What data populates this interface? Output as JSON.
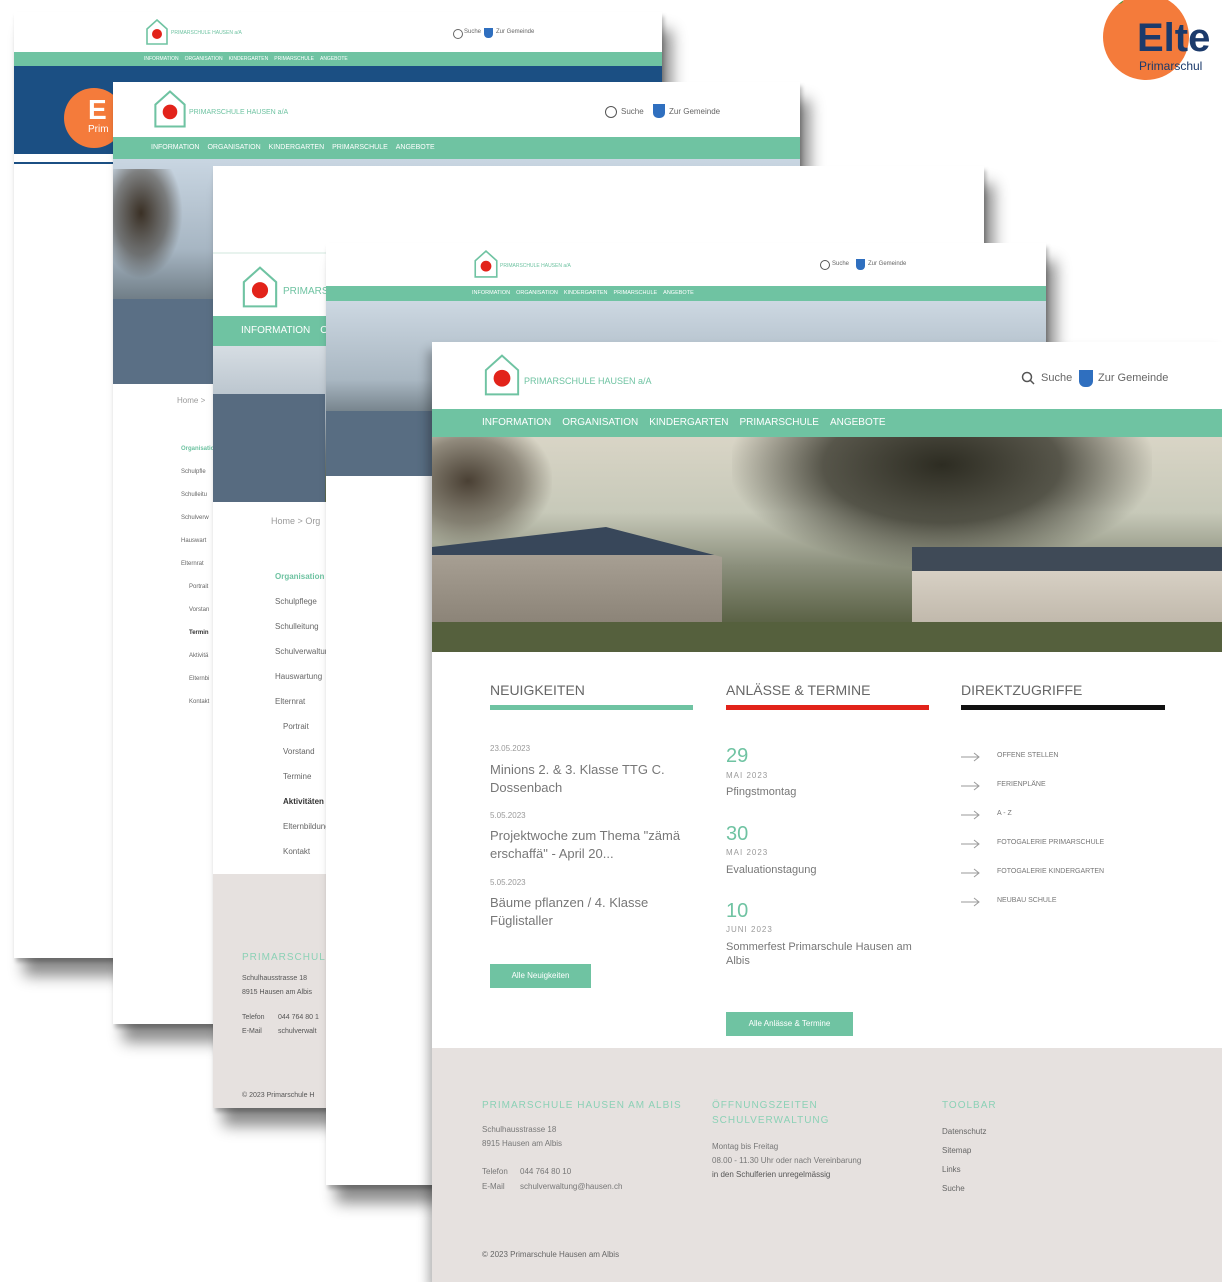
{
  "site": {
    "name": "PRIMARSCHULE HAUSEN a/A",
    "search_label": "Suche",
    "municipality_label": "Zur Gemeinde",
    "nav": [
      "INFORMATION",
      "ORGANISATION",
      "KINDERGARTEN",
      "PRIMARSCHULE",
      "ANGEBOTE"
    ]
  },
  "badge": {
    "big": "Elte",
    "small": "Primarschul",
    "letter": "E",
    "letter_small": "Prim"
  },
  "breadcrumb": {
    "home": "Home",
    "sep": ">",
    "partial": "Org"
  },
  "sidebar": {
    "title": "Organisation",
    "items": [
      "Schulpflege",
      "Schulleitung",
      "Schulverwaltung",
      "Hauswartung",
      "Elternrat"
    ],
    "subitems": [
      "Portrait",
      "Vorstand",
      "Termine",
      "Aktivitäten",
      "Elternbildung",
      "Kontakt"
    ],
    "card2_items": [
      "Organisation",
      "Schulpfle",
      "Schulleitu",
      "Schulverw",
      "Hauswart",
      "Elternrat",
      "Portrait",
      "Vorstan",
      "Termin",
      "Aktivitä",
      "Elternbi",
      "Kontakt"
    ]
  },
  "sections": {
    "news": {
      "title": "NEUIGKEITEN",
      "items": [
        {
          "date": "23.05.2023",
          "title_line1": "Minions 2. & 3. Klasse TTG C.",
          "title_line2": "Dossenbach"
        },
        {
          "date": "5.05.2023",
          "title_line1": "Projektwoche zum Thema \"zämä",
          "title_line2": "erschaffä\" - April 20..."
        },
        {
          "date": "5.05.2023",
          "title_line1": "Bäume pflanzen / 4. Klasse",
          "title_line2": "Füglistaller"
        }
      ],
      "button": "Alle Neuigkeiten"
    },
    "events": {
      "title": "ANLÄSSE & TERMINE",
      "items": [
        {
          "day": "29",
          "month": "MAI 2023",
          "title_line1": "Pfingstmontag",
          "title_line2": ""
        },
        {
          "day": "30",
          "month": "MAI 2023",
          "title_line1": "Evaluationstagung",
          "title_line2": ""
        },
        {
          "day": "10",
          "month": "JUNI 2023",
          "title_line1": "Sommerfest Primarschule Hausen am",
          "title_line2": "Albis"
        }
      ],
      "button": "Alle Anlässe & Termine"
    },
    "quick": {
      "title": "DIREKTZUGRIFFE",
      "items": [
        "OFFENE STELLEN",
        "FERIENPLÄNE",
        "A - Z",
        "FOTOGALERIE PRIMARSCHULE",
        "FOTOGALERIE KINDERGARTEN",
        "NEUBAU SCHULE"
      ]
    }
  },
  "footer": {
    "col1_title": "PRIMARSCHULE HAUSEN AM ALBIS",
    "col1_title_short": "PRIMARSCHUL",
    "address1": "Schulhausstrasse 18",
    "address2": "8915 Hausen am Albis",
    "phone_label": "Telefon",
    "phone": "044 764 80 10",
    "phone_short": "044 764 80 1",
    "email_label": "E-Mail",
    "email": "schulverwaltung@hausen.ch",
    "email_short": "schulverwalt",
    "col2_title1": "ÖFFNUNGSZEITEN",
    "col2_title2": "SCHULVERWALTUNG",
    "hours1": "Montag bis Freitag",
    "hours2": "08.00 - 11.30 Uhr oder nach Vereinbarung",
    "hours3": "in den Schulferien unregelmässig",
    "col3_title": "TOOLBAR",
    "tools": [
      "Datenschutz",
      "Sitemap",
      "Links",
      "Suche"
    ],
    "copyright": "© 2023 Primarschule Hausen am Albis",
    "copyright_short": "© 2023 Primarschule H"
  },
  "colors": {
    "accent": "#6fc3a2",
    "events_bar": "#e2231a",
    "quick_bar": "#111111",
    "footer_bg": "#e6e1df",
    "badge": "#f47b3b"
  }
}
